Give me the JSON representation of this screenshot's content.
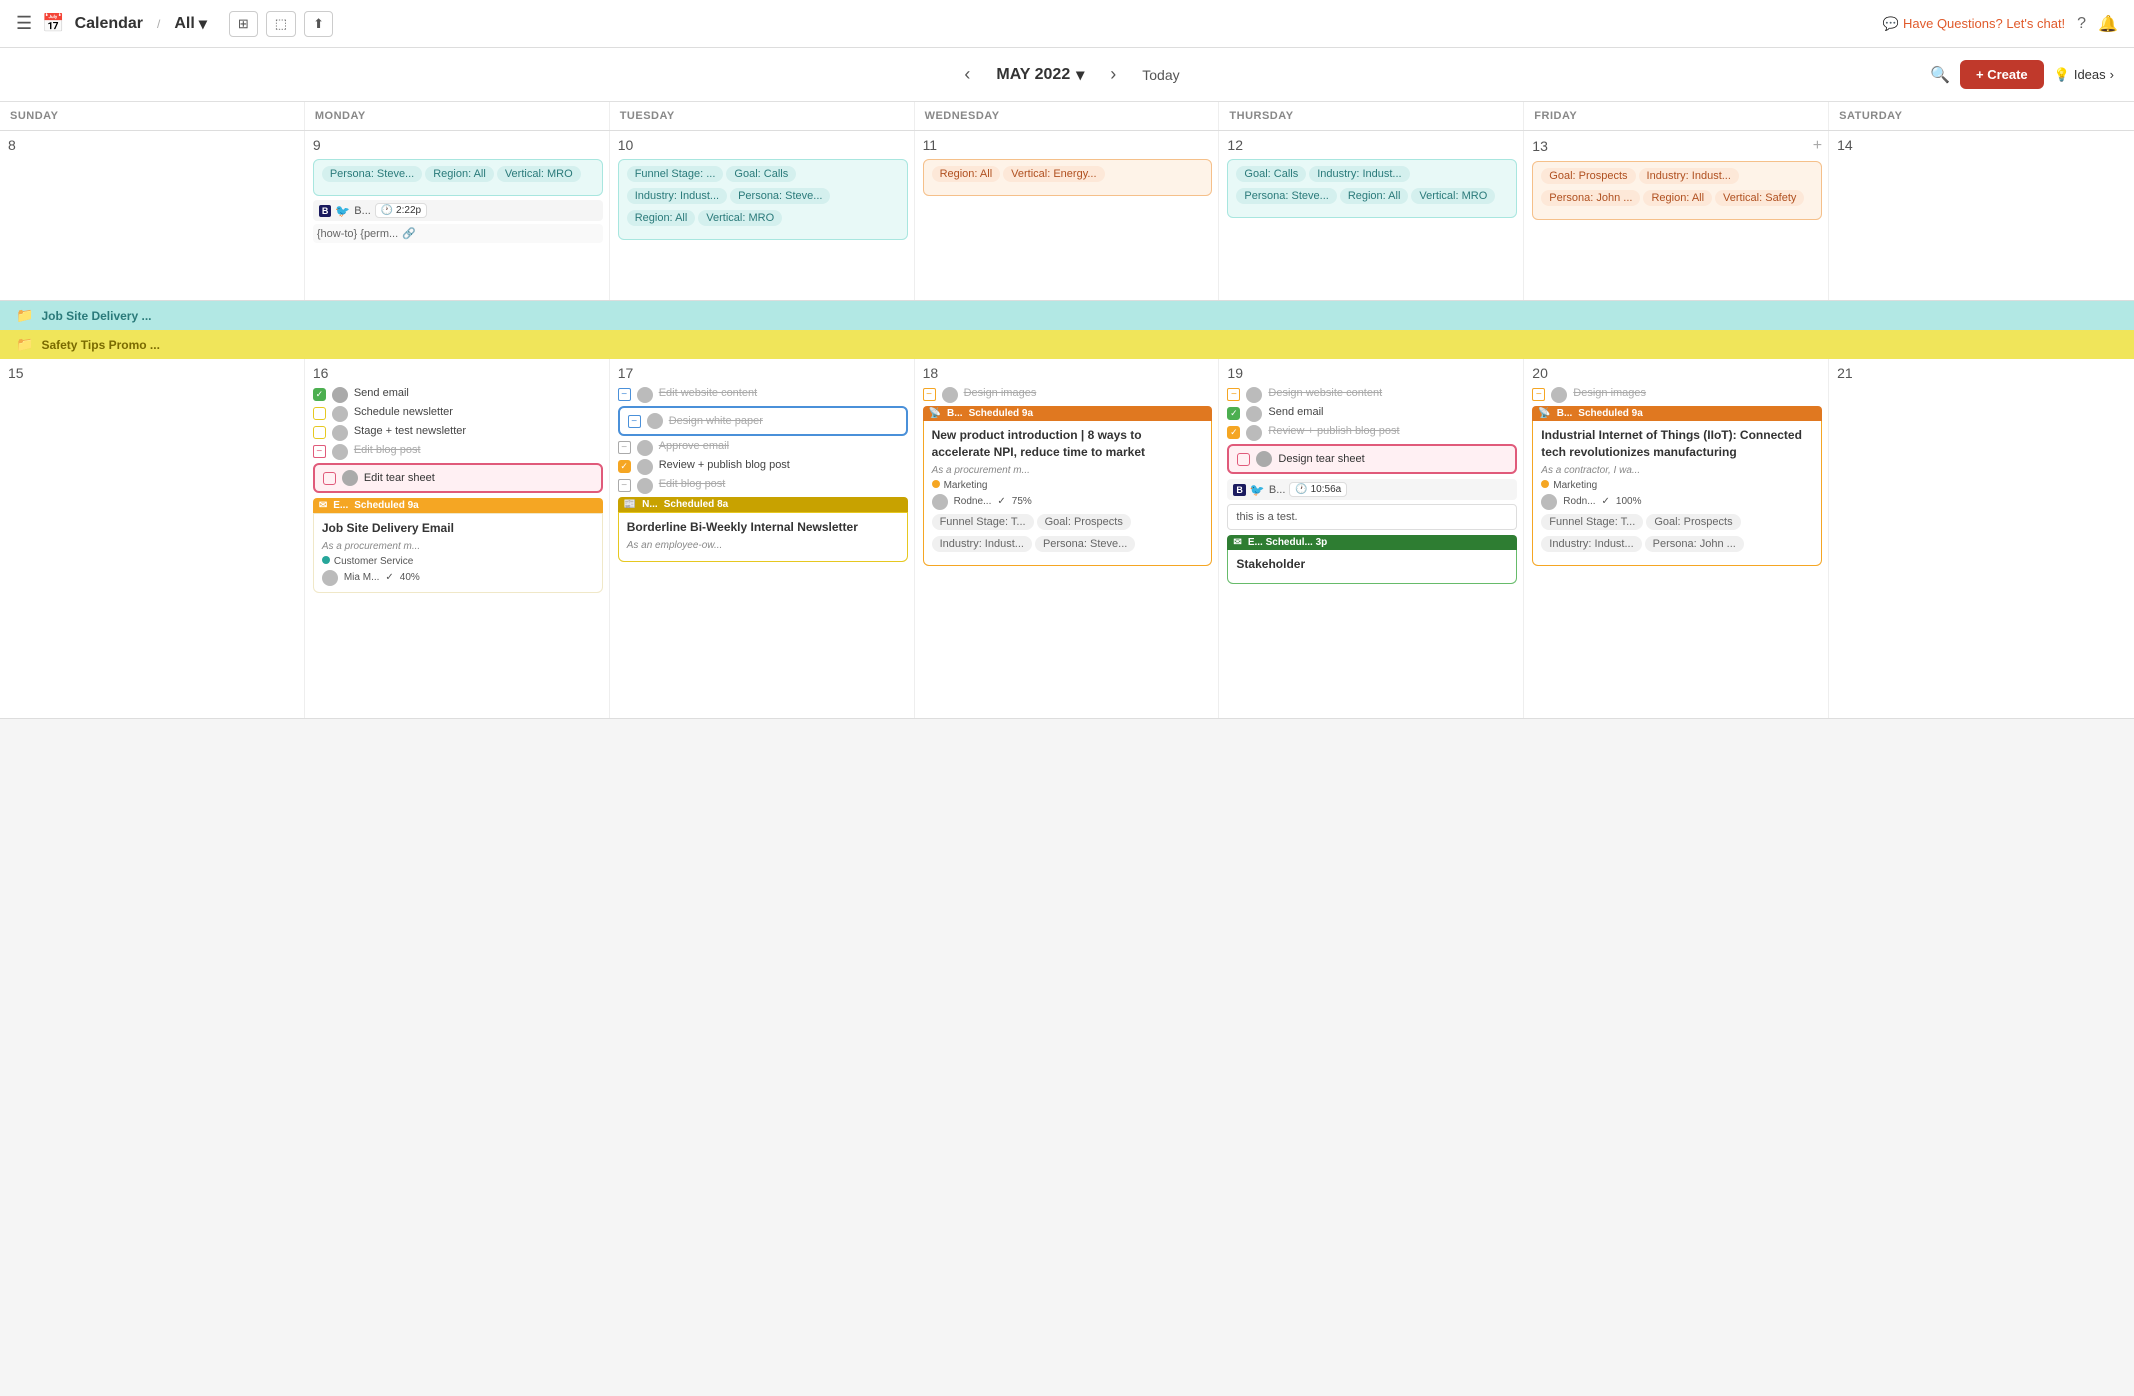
{
  "topnav": {
    "menu_icon": "☰",
    "calendar_icon": "📅",
    "title": "Calendar",
    "separator": "/",
    "view": "All",
    "dropdown_arrow": "▾",
    "filter_icon": "⊞",
    "monitor_icon": "⬚",
    "share_icon": "⬆",
    "chat_icon": "💬",
    "chat_text": "Have Questions? Let's chat!",
    "help_icon": "?",
    "bell_icon": "🔔"
  },
  "cal_header": {
    "prev": "‹",
    "next": "›",
    "month": "MAY 2022",
    "dropdown": "▾",
    "today": "Today",
    "search": "🔍",
    "create": "+ Create",
    "bulb": "💡",
    "ideas": "Ideas",
    "ideas_arrow": "›"
  },
  "day_headers": [
    "SUNDAY",
    "MONDAY",
    "TUESDAY",
    "WEDNESDAY",
    "THURSDAY",
    "FRIDAY",
    "SATURDAY"
  ],
  "week1": {
    "days": [
      {
        "num": "8",
        "events": []
      },
      {
        "num": "9",
        "chips": [
          "Persona: Steve...",
          "Region: All",
          "Vertical: MRO"
        ],
        "has_social": true,
        "social_time": "2:22p",
        "has_perma": true,
        "perma_text": "{how-to} {perm..."
      },
      {
        "num": "10",
        "chips": [
          "Funnel Stage: ...",
          "Goal: Calls",
          "Industry: Indust...",
          "Persona: Steve...",
          "Region: All",
          "Vertical: MRO"
        ]
      },
      {
        "num": "11",
        "chips": [
          "Region: All",
          "Vertical: Energy..."
        ]
      },
      {
        "num": "12",
        "chips": [
          "Goal: Calls",
          "Industry: Indust...",
          "Persona: Steve...",
          "Region: All",
          "Vertical: MRO"
        ]
      },
      {
        "num": "13",
        "chips": [
          "Goal: Prospects",
          "Industry: Indust...",
          "Persona: John ...",
          "Region: All",
          "Vertical: Safety"
        ],
        "has_plus": true
      },
      {
        "num": "14",
        "events": []
      }
    ]
  },
  "banners": [
    {
      "color": "teal",
      "text": "Job Site Delivery ..."
    },
    {
      "color": "yellow",
      "text": "Safety Tips Promo ..."
    }
  ],
  "week2": {
    "days": [
      {
        "num": "15",
        "events": []
      },
      {
        "num": "16",
        "tasks": [
          {
            "type": "checked-green",
            "text": "Send email"
          },
          {
            "type": "unchecked-yellow",
            "text": "Schedule newsletter"
          },
          {
            "type": "unchecked-yellow",
            "text": "Stage + test newsletter"
          },
          {
            "type": "minus-red",
            "text": "Edit blog post"
          },
          {
            "type": "unchecked-pink",
            "text": "Edit tear sheet",
            "highlight": true
          }
        ],
        "has_scheduled": true,
        "scheduled_time": "9a",
        "newsletter_title": "Job Site Delivery Email",
        "newsletter_sub": "As a procurement m...",
        "newsletter_dot": "teal",
        "newsletter_dept": "Customer Service",
        "newsletter_person": "Mia M...",
        "newsletter_progress": "40%"
      },
      {
        "num": "17",
        "tasks": [
          {
            "type": "minus-blue",
            "text": "Edit website content",
            "strike": true
          },
          {
            "type": "outlined-blue",
            "text": "Design white paper",
            "highlight_blue": true
          },
          {
            "type": "minus-gray",
            "text": "Approve email",
            "strike": true
          },
          {
            "type": "checked-orange",
            "text": "Review + publish blog post"
          },
          {
            "type": "minus-gray2",
            "text": "Edit blog post",
            "strike": true
          }
        ],
        "has_newsletter_yellow": true,
        "newsletter_time": "8a",
        "newsletter_title": "Borderline Bi-Weekly Internal Newsletter",
        "newsletter_sub": "As an employee-ow..."
      },
      {
        "num": "18",
        "tasks": [
          {
            "type": "minus-orange",
            "text": "Design images",
            "strike": true
          }
        ],
        "has_scheduled_orange": true,
        "scheduled_time": "9a",
        "article_title": "New product introduction | 8 ways to accelerate NPI, reduce time to market",
        "article_sub": "As a procurement m...",
        "article_dot": "orange",
        "article_dept": "Marketing",
        "article_person": "Rodne...",
        "article_progress": "75%",
        "chips_bottom": [
          "Funnel Stage: T...",
          "Goal: Prospects",
          "Industry: Indust...",
          "Persona: Steve..."
        ]
      },
      {
        "num": "19",
        "tasks": [
          {
            "type": "minus-orange2",
            "text": "Design website content",
            "strike": true
          },
          {
            "type": "checked-green2",
            "text": "Send email"
          },
          {
            "type": "checked-orange2",
            "text": "Review + publish blog post"
          }
        ],
        "has_tear_sheet": true,
        "has_social2": true,
        "social_time2": "10:56a",
        "test_note": "this is a test.",
        "has_scheduled_green": true,
        "scheduled_time2": "3p",
        "scheduled_label": "Schedul... 3p",
        "stakeholder_title": "Stakeholder"
      },
      {
        "num": "20",
        "tasks": [
          {
            "type": "minus-orange3",
            "text": "Design images",
            "strike": true
          }
        ],
        "has_scheduled_orange2": true,
        "scheduled_time": "9a",
        "article_title2": "Industrial Internet of Things (IIoT): Connected tech revolutionizes manufacturing",
        "article_sub2": "As a contractor, I wa...",
        "article_dot2": "orange",
        "article_dept2": "Marketing",
        "article_person2": "Rodn...",
        "article_progress2": "100%",
        "chips_bottom2": [
          "Funnel Stage: T...",
          "Goal: Prospects",
          "Industry: Indust...",
          "Persona: John ..."
        ]
      },
      {
        "num": "21",
        "events": []
      }
    ]
  }
}
